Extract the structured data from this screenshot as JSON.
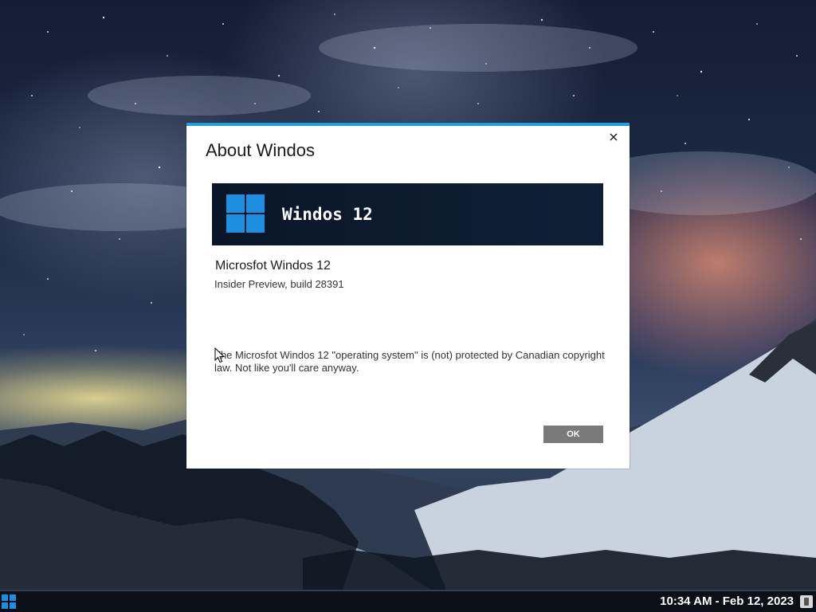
{
  "dialog": {
    "title": "About Windos",
    "close_label": "×",
    "banner_title": "Windos 12",
    "product_name": "Microsfot Windos 12",
    "build_info": "Insider Preview, build 28391",
    "legal_text": "The Microsfot Windos 12 \"operating system\" is (not) protected by Canadian copyright law. Not like you'll care anyway.",
    "ok_label": "OK",
    "accent_color": "#1ba1e2",
    "logo_color": "#1e8fe0"
  },
  "taskbar": {
    "start_icon": "windows-logo-icon",
    "clock": "10:34 AM - Feb 12, 2023",
    "tray_icon": "tray-app-icon"
  },
  "desktop": {
    "wallpaper": "snowy mountains under starry night sky"
  }
}
